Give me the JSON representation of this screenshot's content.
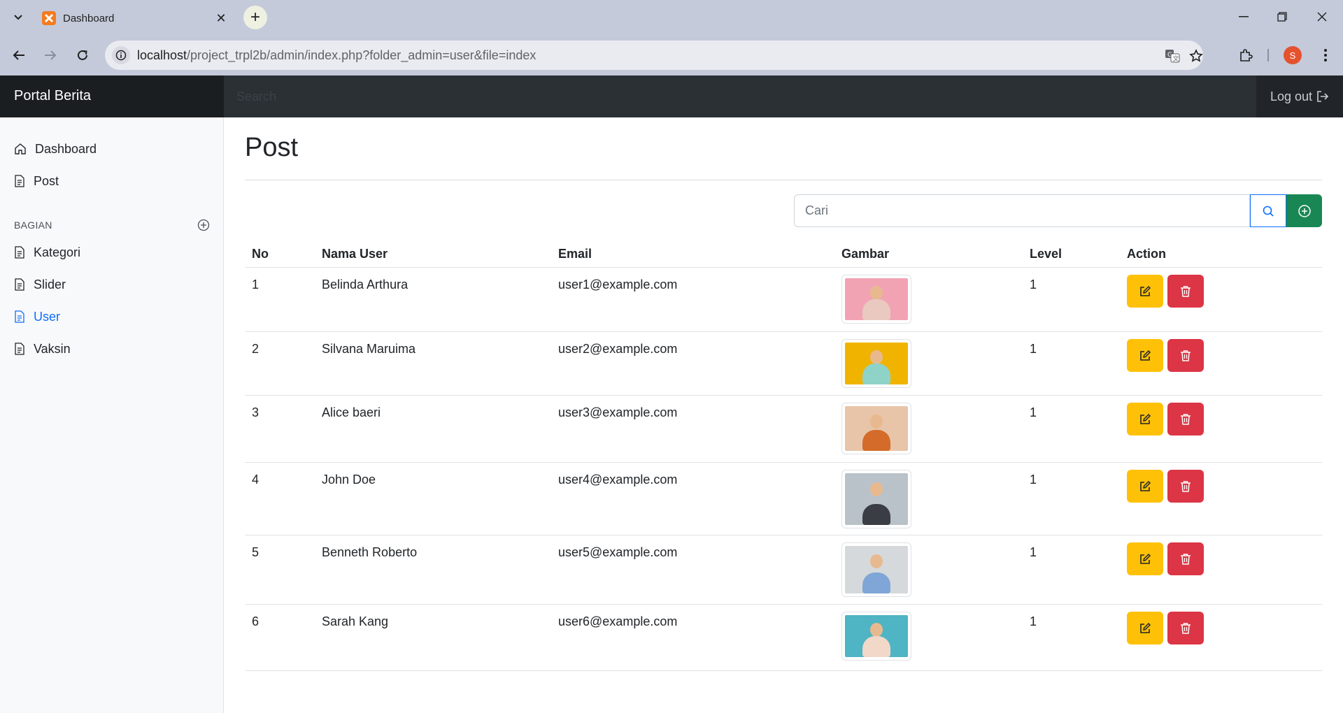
{
  "browser": {
    "tab_title": "Dashboard",
    "url_host": "localhost",
    "url_path": "/project_trpl2b/admin/index.php?folder_admin=user&file=index",
    "profile_initial": "S"
  },
  "app": {
    "brand": "Portal Berita",
    "search_placeholder": "Search",
    "logout_label": "Log out"
  },
  "sidebar": {
    "items": [
      {
        "label": "Dashboard",
        "icon": "house-icon"
      },
      {
        "label": "Post",
        "icon": "file-icon"
      }
    ],
    "section_heading": "BAGIAN",
    "section_items": [
      {
        "label": "Kategori",
        "icon": "file-icon"
      },
      {
        "label": "Slider",
        "icon": "file-icon"
      },
      {
        "label": "User",
        "icon": "file-icon",
        "active": true
      },
      {
        "label": "Vaksin",
        "icon": "file-icon"
      }
    ]
  },
  "main": {
    "title": "Post",
    "search_placeholder": "Cari",
    "table": {
      "headers": [
        "No",
        "Nama User",
        "Email",
        "Gambar",
        "Level",
        "Action"
      ],
      "rows": [
        {
          "no": "1",
          "name": "Belinda Arthura",
          "email": "user1@example.com",
          "level": "1",
          "img_bg": "#f2a3b3",
          "shirt": "#e9c9c0"
        },
        {
          "no": "2",
          "name": "Silvana Maruima",
          "email": "user2@example.com",
          "level": "1",
          "img_bg": "#f0b400",
          "shirt": "#8fd3c8"
        },
        {
          "no": "3",
          "name": "Alice baeri",
          "email": "user3@example.com",
          "level": "1",
          "img_bg": "#e8c4a8",
          "shirt": "#d46b2a"
        },
        {
          "no": "4",
          "name": "John Doe",
          "email": "user4@example.com",
          "level": "1",
          "img_bg": "#b9c2c8",
          "shirt": "#3a3d44"
        },
        {
          "no": "5",
          "name": "Benneth Roberto",
          "email": "user5@example.com",
          "level": "1",
          "img_bg": "#d5d9dc",
          "shirt": "#7fa6d6"
        },
        {
          "no": "6",
          "name": "Sarah Kang",
          "email": "user6@example.com",
          "level": "1",
          "img_bg": "#4fb4c3",
          "shirt": "#f1d8c8"
        }
      ]
    }
  },
  "colors": {
    "edit": "#ffc107",
    "delete": "#dc3545",
    "add": "#198754",
    "active_link": "#0d6efd"
  }
}
